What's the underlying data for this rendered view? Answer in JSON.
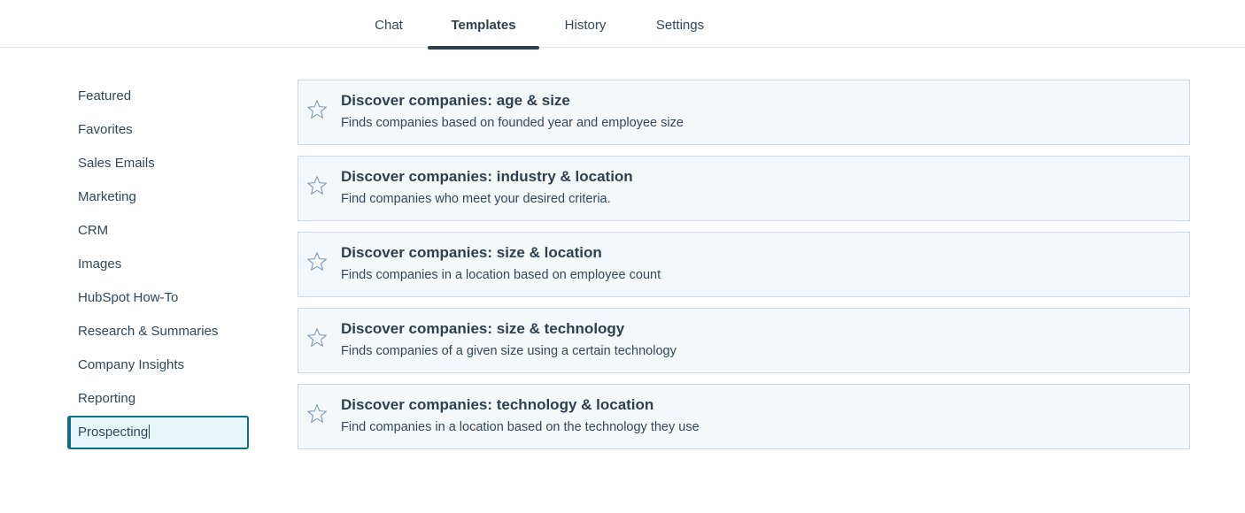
{
  "tabs": [
    {
      "label": "Chat"
    },
    {
      "label": "Templates"
    },
    {
      "label": "History"
    },
    {
      "label": "Settings"
    }
  ],
  "active_tab": "Templates",
  "sidebar": {
    "items": [
      {
        "label": "Featured"
      },
      {
        "label": "Favorites"
      },
      {
        "label": "Sales Emails"
      },
      {
        "label": "Marketing"
      },
      {
        "label": "CRM"
      },
      {
        "label": "Images"
      },
      {
        "label": "HubSpot How-To"
      },
      {
        "label": "Research & Summaries"
      },
      {
        "label": "Company Insights"
      },
      {
        "label": "Reporting"
      },
      {
        "label": "Prospecting"
      }
    ],
    "active": "Prospecting"
  },
  "templates": [
    {
      "title": "Discover companies: age & size",
      "description": "Finds companies based on founded year and employee size",
      "icon": "star-outline-icon"
    },
    {
      "title": "Discover companies: industry & location",
      "description": "Find companies who meet your desired criteria.",
      "icon": "star-outline-icon"
    },
    {
      "title": "Discover companies: size & location",
      "description": "Finds companies in a location based on employee count",
      "icon": "star-outline-icon"
    },
    {
      "title": "Discover companies: size & technology",
      "description": "Finds companies of a given size using a certain technology",
      "icon": "star-outline-icon"
    },
    {
      "title": "Discover companies: technology & location",
      "description": "Find companies in a location based on the technology they use",
      "icon": "star-outline-icon"
    }
  ],
  "colors": {
    "text": "#33475b",
    "heading": "#2e3f50",
    "card_bg": "#f5f8fb",
    "card_border": "#cbd6e2",
    "active_bg": "#e5f5f8",
    "active_border": "#0b6f8a"
  }
}
